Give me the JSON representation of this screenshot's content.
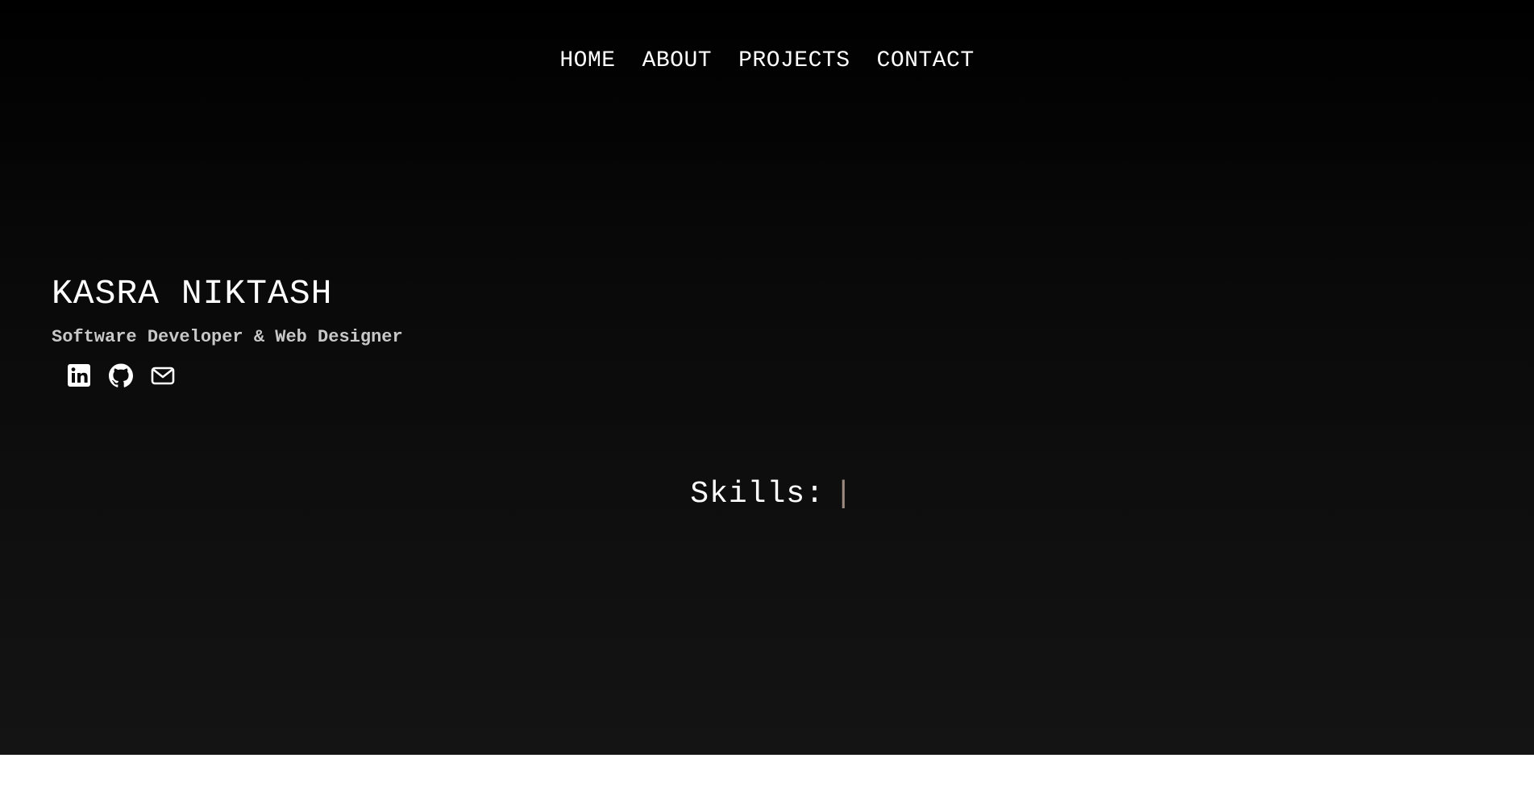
{
  "nav": {
    "items": [
      {
        "label": "HOME"
      },
      {
        "label": "ABOUT"
      },
      {
        "label": "PROJECTS"
      },
      {
        "label": "CONTACT"
      }
    ]
  },
  "hero": {
    "name": "KASRA NIKTASH",
    "subtitle": "Software Developer & Web Designer",
    "socials": [
      {
        "icon": "linkedin-icon"
      },
      {
        "icon": "github-icon"
      },
      {
        "icon": "mail-icon"
      }
    ],
    "skills_label": "Skills:",
    "cursor": "|"
  },
  "colors": {
    "background_top": "#000000",
    "background_bottom": "#141414",
    "text": "#ffffff",
    "subtitle": "#c8c8c8",
    "cursor": "#9a8a80"
  }
}
